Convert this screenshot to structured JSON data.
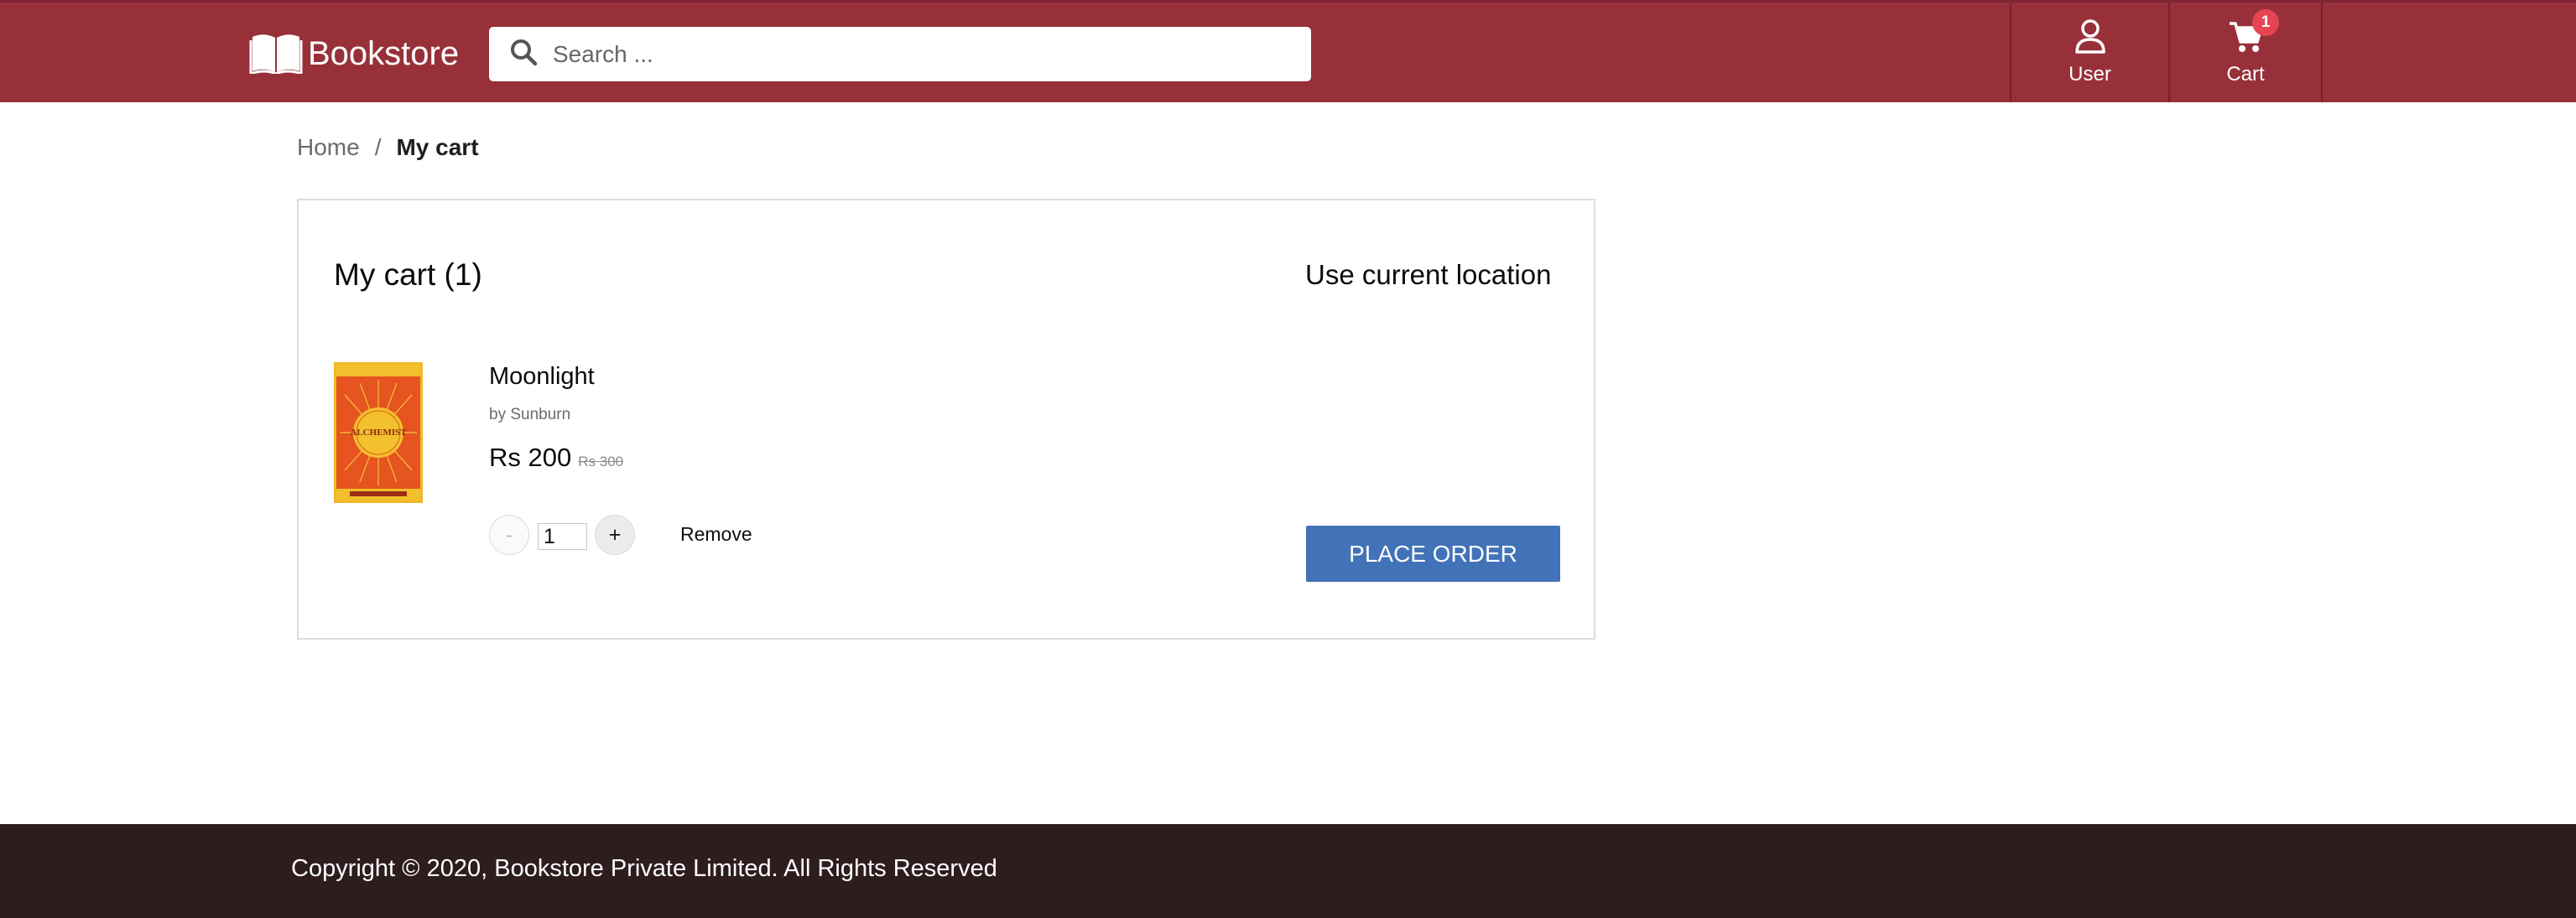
{
  "header": {
    "logo_text": "Bookstore",
    "search_placeholder": "Search ...",
    "user_label": "User",
    "cart_label": "Cart",
    "cart_count": "1",
    "brand_color": "#98303a"
  },
  "breadcrumb": {
    "home": "Home",
    "separator": "/",
    "current": "My cart"
  },
  "cart": {
    "title": "My cart (1)",
    "location_link": "Use current location",
    "item": {
      "name": "Moonlight",
      "author": "by Sunburn",
      "price": "Rs 200",
      "original_price": "Rs 300",
      "quantity": "1",
      "minus_label": "-",
      "plus_label": "+",
      "remove_label": "Remove",
      "cover_title": "ALCHEMIST",
      "cover_icon": "book-cover-image"
    },
    "place_order_label": "PLACE ORDER",
    "accent_color": "#4273b8"
  },
  "footer": {
    "copyright": "Copyright © 2020, Bookstore Private Limited. All Rights Reserved"
  }
}
